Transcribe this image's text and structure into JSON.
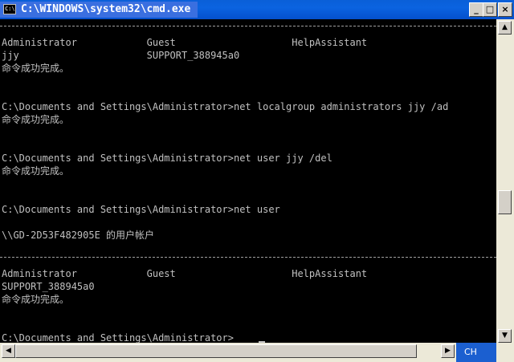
{
  "window": {
    "title": "C:\\WINDOWS\\system32\\cmd.exe",
    "icon_label": "C:\\",
    "buttons": {
      "minimize": "_",
      "maximize": "□",
      "close": "×"
    }
  },
  "console": {
    "lines": [
      "Administrator            Guest                    HelpAssistant",
      "jjy                      SUPPORT_388945a0",
      "命令成功完成。",
      "C:\\Documents and Settings\\Administrator>net localgroup administrators jjy /ad",
      "命令成功完成。",
      "C:\\Documents and Settings\\Administrator>net user jjy /del",
      "命令成功完成。",
      "C:\\Documents and Settings\\Administrator>net user",
      "\\\\GD-2D53F482905E 的用户帐户",
      "Administrator            Guest                    HelpAssistant",
      "SUPPORT_388945a0",
      "命令成功完成。",
      "C:\\Documents and Settings\\Administrator>"
    ]
  },
  "scrollbars": {
    "up": "▲",
    "down": "▼",
    "left": "◀",
    "right": "▶"
  },
  "ime": {
    "label": "CH"
  },
  "colors": {
    "console_bg": "#000000",
    "console_fg": "#c0c0c0",
    "titlebar": "#0a5fd8"
  }
}
